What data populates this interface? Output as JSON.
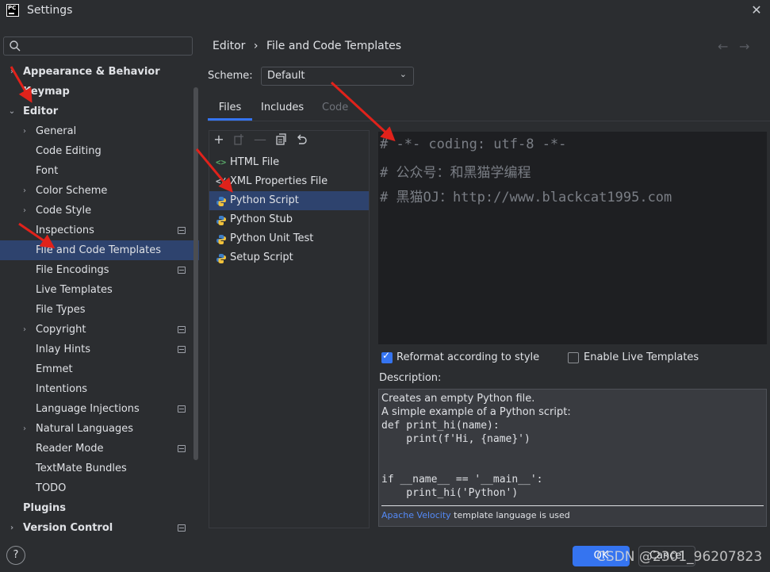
{
  "window": {
    "title": "Settings",
    "logo_text": "PC"
  },
  "sidebar": {
    "search_placeholder": "",
    "items": [
      {
        "label": "Appearance & Behavior",
        "level": 0,
        "bold": true,
        "expandable": true,
        "expanded": false
      },
      {
        "label": "Keymap",
        "level": 0,
        "bold": true
      },
      {
        "label": "Editor",
        "level": 0,
        "bold": true,
        "expandable": true,
        "expanded": true
      },
      {
        "label": "General",
        "level": 1,
        "expandable": true
      },
      {
        "label": "Code Editing",
        "level": 1
      },
      {
        "label": "Font",
        "level": 1
      },
      {
        "label": "Color Scheme",
        "level": 1,
        "expandable": true
      },
      {
        "label": "Code Style",
        "level": 1,
        "expandable": true
      },
      {
        "label": "Inspections",
        "level": 1,
        "project": true
      },
      {
        "label": "File and Code Templates",
        "level": 1,
        "selected": true
      },
      {
        "label": "File Encodings",
        "level": 1,
        "project": true
      },
      {
        "label": "Live Templates",
        "level": 1
      },
      {
        "label": "File Types",
        "level": 1
      },
      {
        "label": "Copyright",
        "level": 1,
        "expandable": true,
        "project": true
      },
      {
        "label": "Inlay Hints",
        "level": 1,
        "project": true
      },
      {
        "label": "Emmet",
        "level": 1
      },
      {
        "label": "Intentions",
        "level": 1
      },
      {
        "label": "Language Injections",
        "level": 1,
        "project": true
      },
      {
        "label": "Natural Languages",
        "level": 1,
        "expandable": true
      },
      {
        "label": "Reader Mode",
        "level": 1,
        "project": true
      },
      {
        "label": "TextMate Bundles",
        "level": 1
      },
      {
        "label": "TODO",
        "level": 1
      },
      {
        "label": "Plugins",
        "level": 0,
        "bold": true
      },
      {
        "label": "Version Control",
        "level": 0,
        "bold": true,
        "expandable": true,
        "project": true
      }
    ]
  },
  "header": {
    "breadcrumb": [
      "Editor",
      "File and Code Templates"
    ],
    "breadcrumb_separator": "›",
    "back_icon": "←",
    "forward_icon": "→"
  },
  "scheme": {
    "label": "Scheme:",
    "value": "Default"
  },
  "tabs": [
    {
      "label": "Files",
      "active": true
    },
    {
      "label": "Includes",
      "active": false
    },
    {
      "label": "Code",
      "active": false,
      "disabled": true
    }
  ],
  "toolbar": {
    "icons": [
      "add-icon",
      "copy-add-icon",
      "remove-icon",
      "copy-icon",
      "reset-icon"
    ]
  },
  "templates": [
    {
      "label": "HTML File",
      "icon": "html-file-icon"
    },
    {
      "label": "XML Properties File",
      "icon": "xml-file-icon"
    },
    {
      "label": "Python Script",
      "icon": "python-icon",
      "selected": true
    },
    {
      "label": "Python Stub",
      "icon": "python-icon"
    },
    {
      "label": "Python Unit Test",
      "icon": "python-icon"
    },
    {
      "label": "Setup Script",
      "icon": "python-icon"
    }
  ],
  "editor": {
    "lines": [
      "# -*- coding: utf-8 -*-",
      "# 公众号：和黑猫学编程",
      "# 黑猫OJ：http://www.blackcat1995.com"
    ]
  },
  "options": {
    "reformat_label": "Reformat according to style",
    "reformat_checked": true,
    "live_templates_label": "Enable Live Templates",
    "live_templates_checked": false
  },
  "description": {
    "label": "Description:",
    "text_lines": [
      "Creates an empty Python file.",
      "A simple example of a Python script:"
    ],
    "code_lines": [
      "def print_hi(name):",
      "    print(f'Hi, {name}')",
      "",
      "",
      "if __name__ == '__main__':",
      "    print_hi('Python')"
    ],
    "link_text": "Apache Velocity",
    "footer_text": " template language is used"
  },
  "footer": {
    "help_label": "?",
    "ok_label": "OK",
    "cancel_label": "Cancel",
    "watermark": "CSDN @2301_96207823"
  },
  "colors": {
    "background": "#2b2d30",
    "selection": "#2e436e",
    "accent": "#3574f0",
    "editor_bg": "#1e1f22",
    "annotation": "#e0221b"
  }
}
